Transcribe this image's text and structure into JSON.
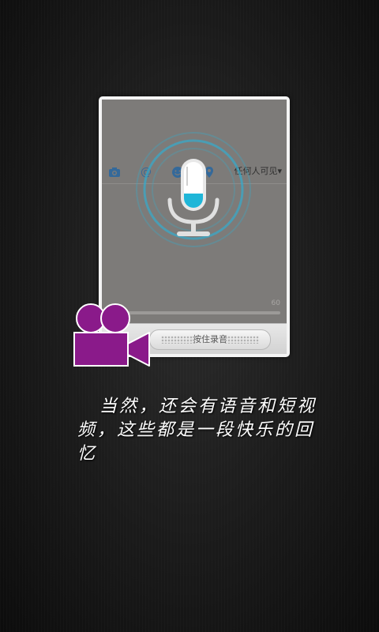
{
  "card": {
    "toolbar": {
      "icons": [
        "camera-icon",
        "at-icon",
        "emoji-icon",
        "location-pin-icon"
      ],
      "visibility_label": "任何人可见▾"
    },
    "char_count": "60",
    "record_button_label": "按住录音"
  },
  "overlays": {
    "mic_icon": "microphone-icon",
    "video_icon": "video-camera-icon"
  },
  "caption": "当然，还会有语音和短视频，这些都是一段快乐的回忆",
  "colors": {
    "background": "#1a1a1a",
    "card_screen": "#7d7b79",
    "ring": "#3aa8c8",
    "badge": "#8a1a8a"
  }
}
